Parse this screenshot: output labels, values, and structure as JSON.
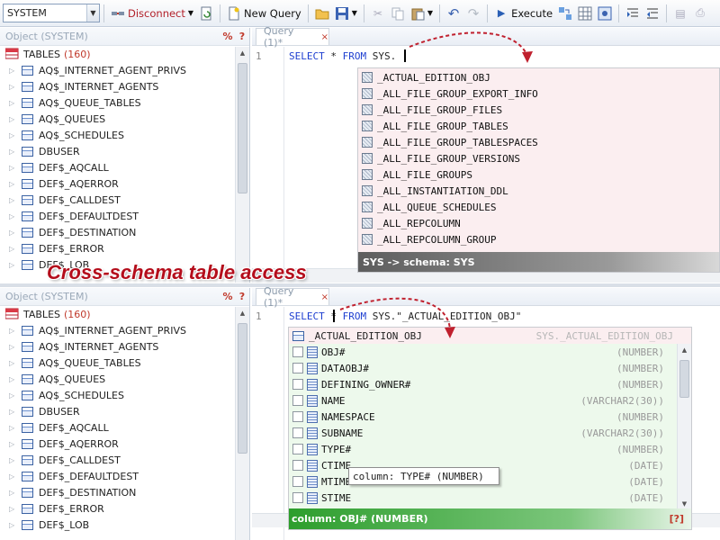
{
  "toolbar": {
    "schema": "SYSTEM",
    "disconnect": "Disconnect",
    "new_query": "New Query",
    "execute": "Execute"
  },
  "object_panel": {
    "title": "Object (SYSTEM)",
    "pct": "%",
    "help": "?",
    "category": "TABLES",
    "count": "(160)",
    "tables_top": [
      "AQ$_INTERNET_AGENT_PRIVS",
      "AQ$_INTERNET_AGENTS",
      "AQ$_QUEUE_TABLES",
      "AQ$_QUEUES",
      "AQ$_SCHEDULES",
      "DBUSER",
      "DEF$_AQCALL",
      "DEF$_AQERROR",
      "DEF$_CALLDEST",
      "DEF$_DEFAULTDEST",
      "DEF$_DESTINATION",
      "DEF$_ERROR",
      "DEF$_LOB"
    ],
    "tables_bottom": [
      "AQ$_INTERNET_AGENT_PRIVS",
      "AQ$_INTERNET_AGENTS",
      "AQ$_QUEUE_TABLES",
      "AQ$_QUEUES",
      "AQ$_SCHEDULES",
      "DBUSER",
      "DEF$_AQCALL",
      "DEF$_AQERROR",
      "DEF$_CALLDEST",
      "DEF$_DEFAULTDEST",
      "DEF$_DESTINATION",
      "DEF$_ERROR",
      "DEF$_LOB"
    ]
  },
  "editor_top": {
    "tab": "Query (1)*",
    "close": "×",
    "line": "1",
    "code_kw1": "SELECT",
    "code_star": " * ",
    "code_kw2": "FROM",
    "code_rest": " SYS."
  },
  "popup_top": {
    "items": [
      "_ACTUAL_EDITION_OBJ",
      "_ALL_FILE_GROUP_EXPORT_INFO",
      "_ALL_FILE_GROUP_FILES",
      "_ALL_FILE_GROUP_TABLES",
      "_ALL_FILE_GROUP_TABLESPACES",
      "_ALL_FILE_GROUP_VERSIONS",
      "_ALL_FILE_GROUPS",
      "_ALL_INSTANTIATION_DDL",
      "_ALL_QUEUE_SCHEDULES",
      "_ALL_REPCOLUMN",
      "_ALL_REPCOLUMN_GROUP"
    ],
    "status": "SYS -> schema: SYS"
  },
  "banner": "Cross-schema table access",
  "editor_bottom": {
    "tab": "Query (1)*",
    "close": "×",
    "line": "1",
    "code_kw1": "SELECT",
    "code_star": " * ",
    "code_kw2": "FROM",
    "code_rest": " SYS.\"_ACTUAL_EDITION_OBJ\""
  },
  "popup_bottom": {
    "table": "_ACTUAL_EDITION_OBJ",
    "table_full": "SYS._ACTUAL_EDITION_OBJ",
    "columns": [
      {
        "name": "OBJ#",
        "type": "(NUMBER)"
      },
      {
        "name": "DATAOBJ#",
        "type": "(NUMBER)"
      },
      {
        "name": "DEFINING_OWNER#",
        "type": "(NUMBER)"
      },
      {
        "name": "NAME",
        "type": "(VARCHAR2(30))"
      },
      {
        "name": "NAMESPACE",
        "type": "(NUMBER)"
      },
      {
        "name": "SUBNAME",
        "type": "(VARCHAR2(30))"
      },
      {
        "name": "TYPE#",
        "type": "(NUMBER)"
      },
      {
        "name": "CTIME",
        "type": "(DATE)"
      },
      {
        "name": "MTIME",
        "type": "(DATE)"
      },
      {
        "name": "STIME",
        "type": "(DATE)"
      }
    ],
    "tooltip": "column: TYPE# (NUMBER)",
    "status": "column: OBJ# (NUMBER)",
    "help": "[?]"
  }
}
